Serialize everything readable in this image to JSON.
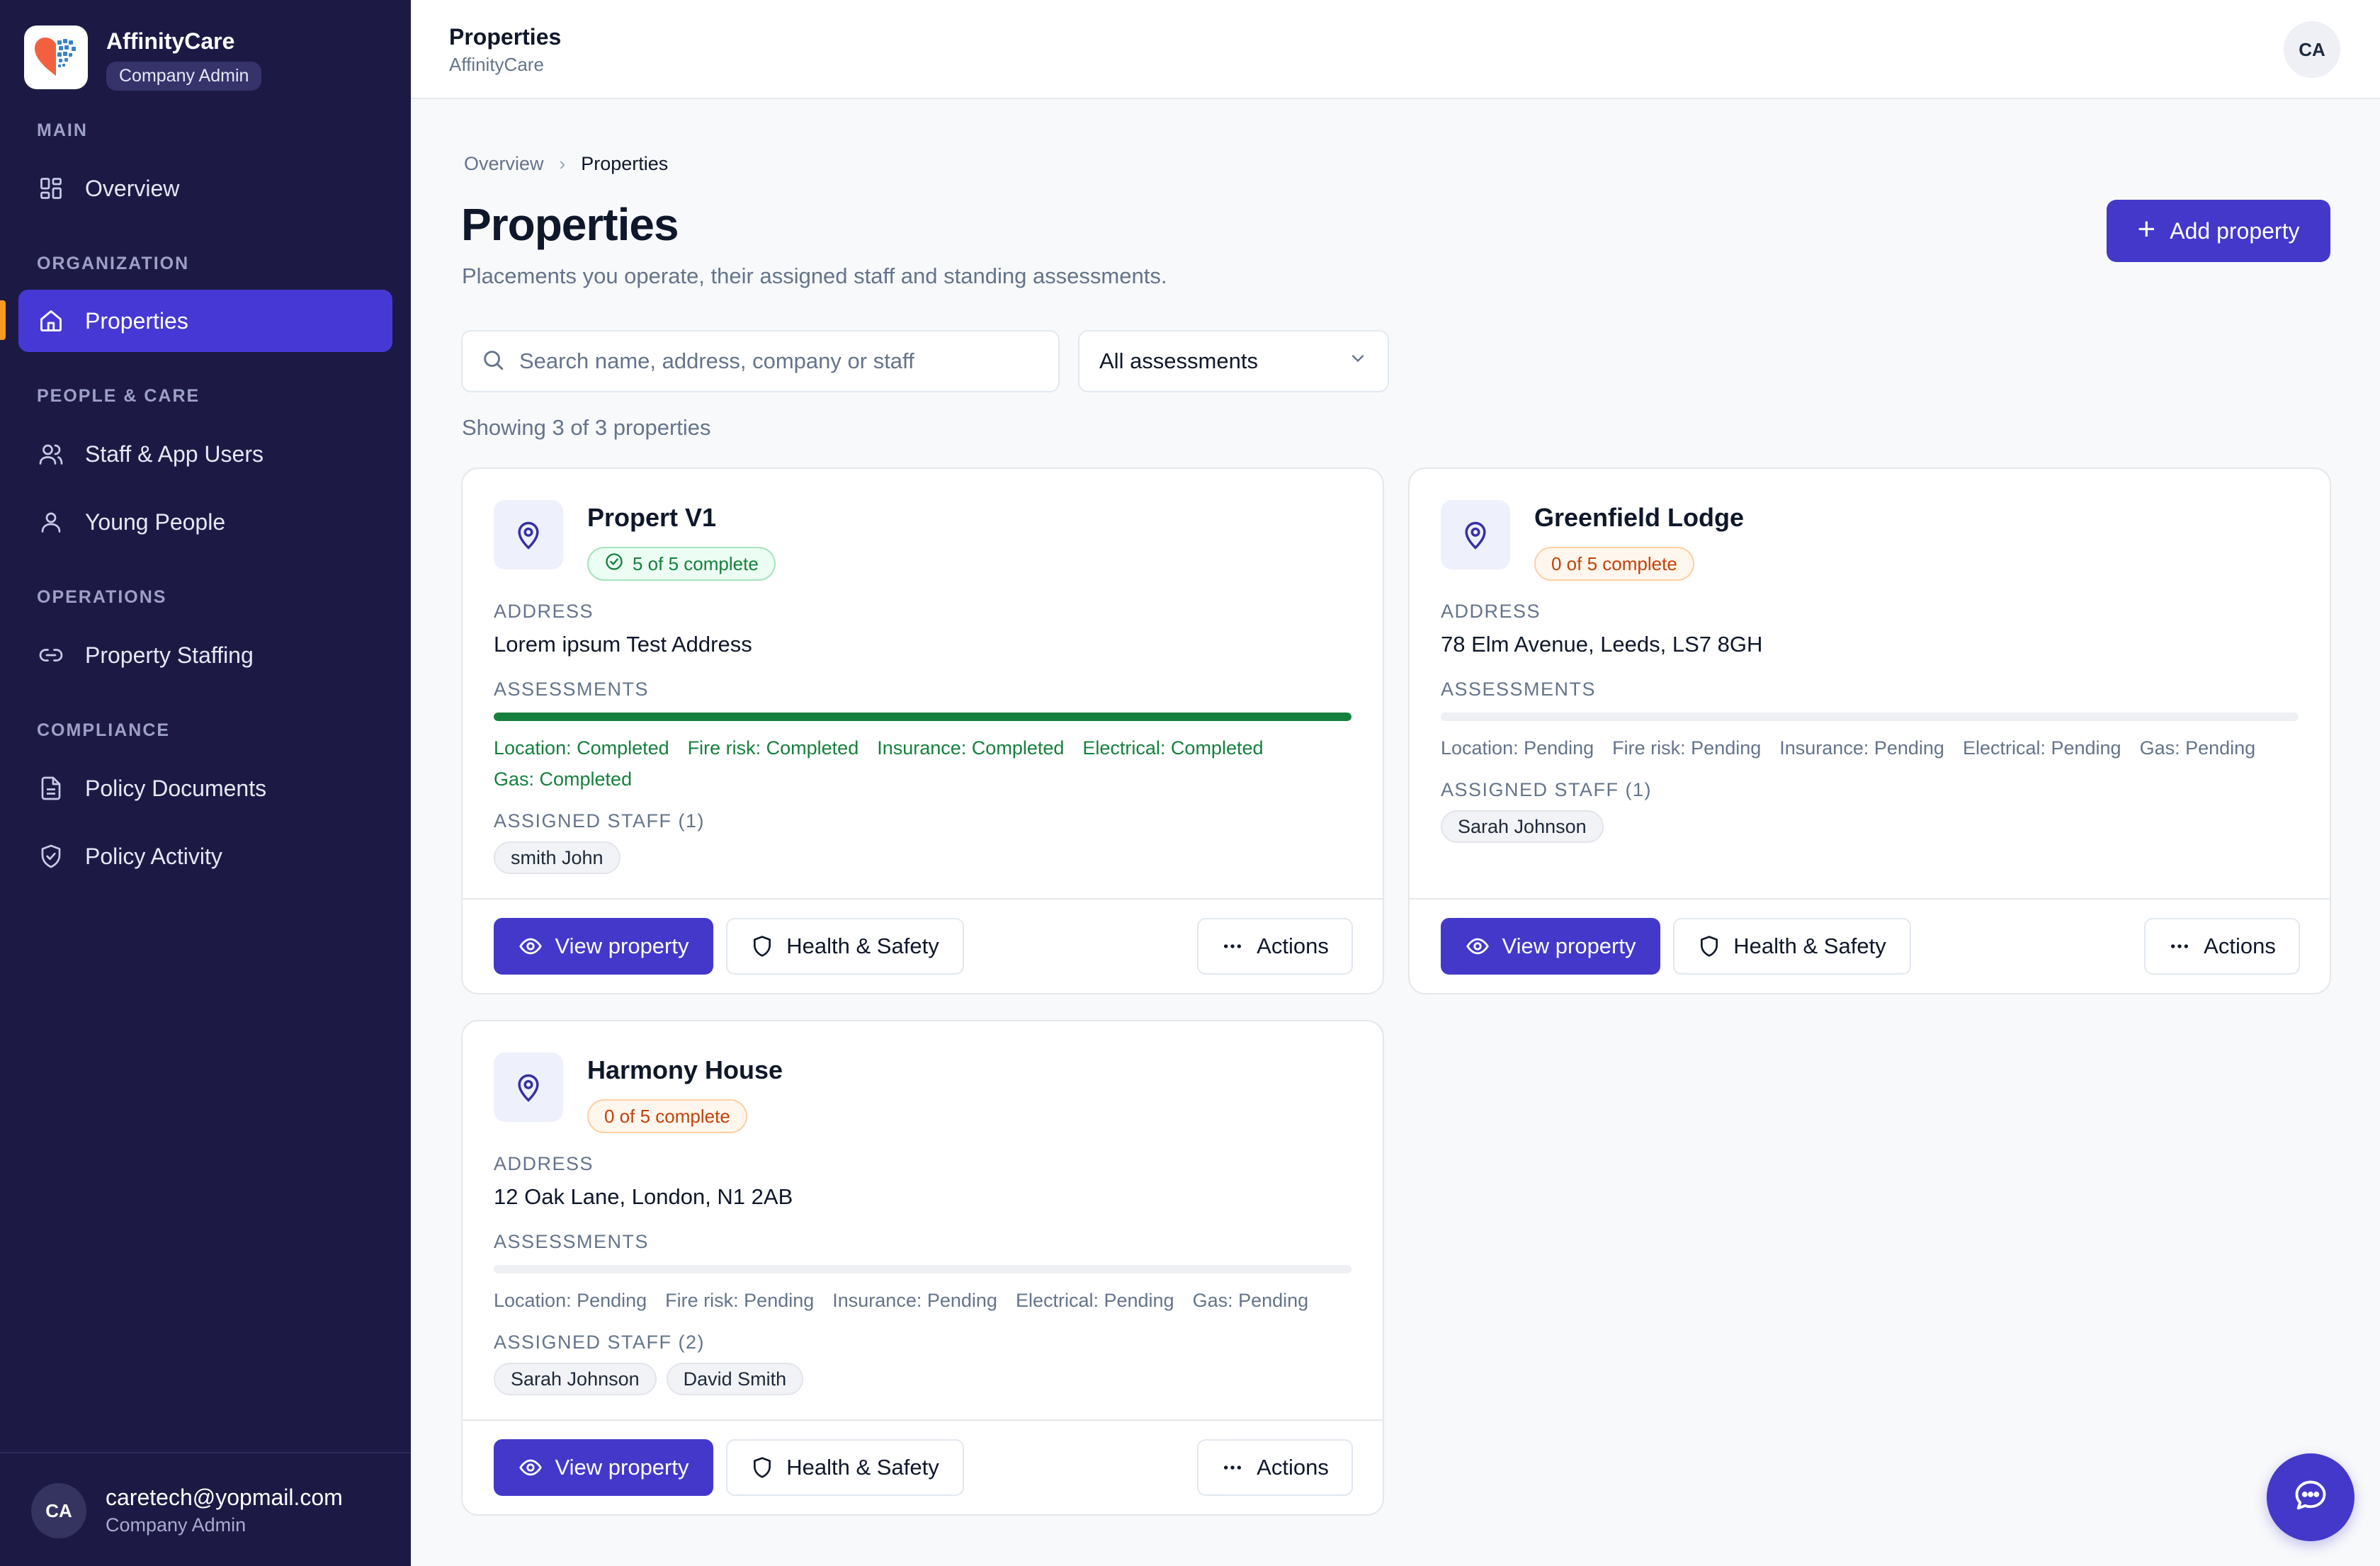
{
  "brand": {
    "name": "AffinityCare",
    "role": "Company Admin"
  },
  "sidebar": {
    "sections": [
      {
        "title": "MAIN",
        "items": [
          {
            "label": "Overview",
            "icon": "grid-icon"
          }
        ]
      },
      {
        "title": "ORGANIZATION",
        "items": [
          {
            "label": "Properties",
            "icon": "home-icon",
            "active": true
          }
        ]
      },
      {
        "title": "PEOPLE & CARE",
        "items": [
          {
            "label": "Staff & App Users",
            "icon": "users-icon"
          },
          {
            "label": "Young People",
            "icon": "user-icon"
          }
        ]
      },
      {
        "title": "OPERATIONS",
        "items": [
          {
            "label": "Property Staffing",
            "icon": "link-icon"
          }
        ]
      },
      {
        "title": "COMPLIANCE",
        "items": [
          {
            "label": "Policy Documents",
            "icon": "document-icon"
          },
          {
            "label": "Policy Activity",
            "icon": "shield-check-icon"
          }
        ]
      }
    ],
    "user": {
      "initials": "CA",
      "email": "caretech@yopmail.com",
      "role": "Company Admin"
    }
  },
  "topbar": {
    "title": "Properties",
    "subtitle": "AffinityCare",
    "avatar": "CA"
  },
  "breadcrumb": {
    "parent": "Overview",
    "current": "Properties"
  },
  "page": {
    "title": "Properties",
    "subtitle": "Placements you operate, their assigned staff and standing assessments.",
    "add_button": "Add property"
  },
  "filters": {
    "search_placeholder": "Search name, address, company or staff",
    "assessment_filter": "All assessments",
    "showing": "Showing 3 of 3 properties"
  },
  "labels": {
    "address": "ADDRESS",
    "assessments": "ASSESSMENTS",
    "view": "View property",
    "health": "Health & Safety",
    "actions": "Actions"
  },
  "properties": [
    {
      "name": "Propert V1",
      "status": "5 of 5 complete",
      "status_type": "complete",
      "progress": 1.0,
      "address": "Lorem ipsum Test Address",
      "assessments": [
        "Location: Completed",
        "Fire risk: Completed",
        "Insurance: Completed",
        "Electrical: Completed",
        "Gas: Completed"
      ],
      "staff_label": "ASSIGNED STAFF (1)",
      "staff": [
        "smith John"
      ]
    },
    {
      "name": "Greenfield Lodge",
      "status": "0 of 5 complete",
      "status_type": "pending",
      "progress": 0.0,
      "address": "78 Elm Avenue, Leeds, LS7 8GH",
      "assessments": [
        "Location: Pending",
        "Fire risk: Pending",
        "Insurance: Pending",
        "Electrical: Pending",
        "Gas: Pending"
      ],
      "staff_label": "ASSIGNED STAFF (1)",
      "staff": [
        "Sarah Johnson"
      ]
    },
    {
      "name": "Harmony House",
      "status": "0 of 5 complete",
      "status_type": "pending",
      "progress": 0.0,
      "address": "12 Oak Lane, London, N1 2AB",
      "assessments": [
        "Location: Pending",
        "Fire risk: Pending",
        "Insurance: Pending",
        "Electrical: Pending",
        "Gas: Pending"
      ],
      "staff_label": "ASSIGNED STAFF (2)",
      "staff": [
        "Sarah Johnson",
        "David Smith"
      ]
    }
  ],
  "colors": {
    "sidebar_bg": "#1c1a45",
    "accent": "#4338ca",
    "success": "#15803d",
    "warning": "#c2410c",
    "active_marker": "#f59a23"
  }
}
